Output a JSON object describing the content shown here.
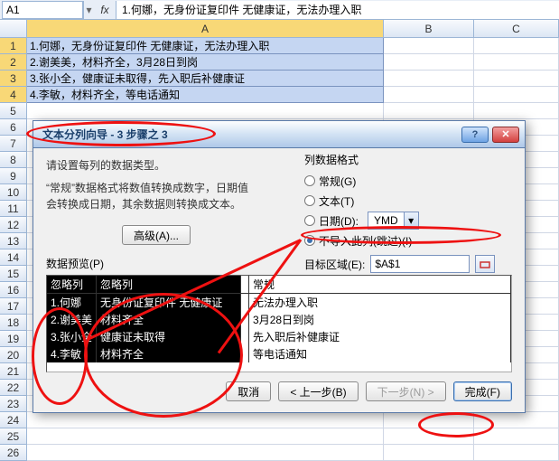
{
  "formula_bar": {
    "cell_ref": "A1",
    "fx_label": "fx",
    "formula": "1.何娜，无身份证复印件 无健康证，无法办理入职"
  },
  "columns": {
    "A": "A",
    "B": "B",
    "C": "C"
  },
  "rows": [
    "1.何娜，无身份证复印件 无健康证，无法办理入职",
    "2.谢美美，材料齐全，3月28日到岗",
    "3.张小全，健康证未取得，先入职后补健康证",
    "4.李敏，材料齐全，等电话通知",
    "",
    "",
    "",
    "",
    "",
    "",
    "",
    "",
    "",
    "",
    "",
    "",
    "",
    "",
    "",
    "",
    "",
    "",
    "",
    "",
    "",
    ""
  ],
  "dialog": {
    "title": "文本分列向导 - 3 步骤之 3",
    "instruction": "请设置每列的数据类型。",
    "desc": "“常规”数据格式将数值转换成数字，日期值会转换成日期，其余数据则转换成文本。",
    "format_group_title": "列数据格式",
    "opt_general": "常规(G)",
    "opt_text": "文本(T)",
    "opt_date": "日期(D):",
    "date_fmt": "YMD",
    "opt_skip": "不导入此列(跳过)(I)",
    "advanced_label": "高级(A)...",
    "target_label": "目标区域(E):",
    "target_value": "$A$1",
    "preview_label": "数据预览(P)",
    "preview_headers": [
      "忽略列",
      "忽略列",
      "",
      "常规"
    ],
    "preview_rows": [
      [
        "1.何娜",
        "无身份证复印件 无健康证",
        "",
        "无法办理入职"
      ],
      [
        "2.谢美美",
        "材料齐全",
        "",
        "3月28日到岗"
      ],
      [
        "3.张小全",
        "健康证未取得",
        "",
        "先入职后补健康证"
      ],
      [
        "4.李敏",
        "材料齐全",
        "",
        "等电话通知"
      ]
    ],
    "btn_cancel": "取消",
    "btn_back": "< 上一步(B)",
    "btn_next": "下一步(N) >",
    "btn_finish": "完成(F)"
  }
}
